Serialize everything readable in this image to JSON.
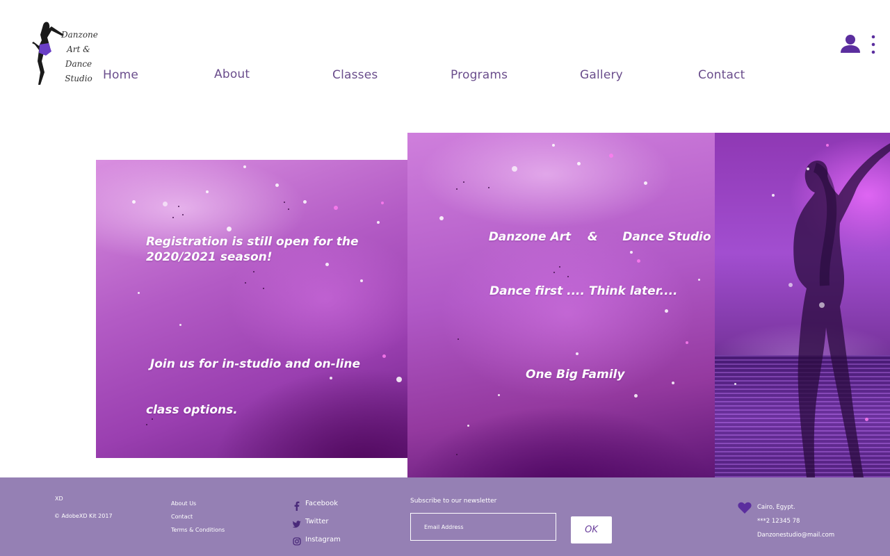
{
  "brand": {
    "logo_lines": [
      "Danzone",
      "Art &",
      "Dance",
      "Studio"
    ],
    "accent": "#6a3f9c",
    "footer_bg": "#9580b4"
  },
  "nav": {
    "items": [
      "Home",
      "About",
      "Classes",
      "Programs",
      "Gallery",
      "Contact"
    ]
  },
  "header_icons": [
    "user-icon",
    "more-vertical-icon"
  ],
  "hero": {
    "left": {
      "line1": "Registration is still open for the",
      "line2": "2020/2021 season!",
      "line3": " Join us for in-studio and on-line",
      "line4": "class options."
    },
    "middle": {
      "title_part1": "Danzone Art",
      "title_amp": "&",
      "title_part2": "Dance Studio",
      "tagline": "Dance first .... Think later....",
      "motto": "One Big Family"
    }
  },
  "footer": {
    "xd": "XD",
    "copyright": "© AdobeXD Kit 2017",
    "links": [
      "About Us",
      "Contact",
      "Terms & Conditions"
    ],
    "social": [
      {
        "icon": "facebook-icon",
        "label": "Facebook"
      },
      {
        "icon": "twitter-icon",
        "label": "Twitter"
      },
      {
        "icon": "instagram-icon",
        "label": "Instagram"
      }
    ],
    "newsletter": {
      "title": "Subscribe to our newsletter",
      "placeholder": "Email Address",
      "button": "OK"
    },
    "contact": {
      "location": "Cairo, Egypt.",
      "phone": "***2 12345 78",
      "email": "Danzonestudio@mail.com"
    }
  }
}
